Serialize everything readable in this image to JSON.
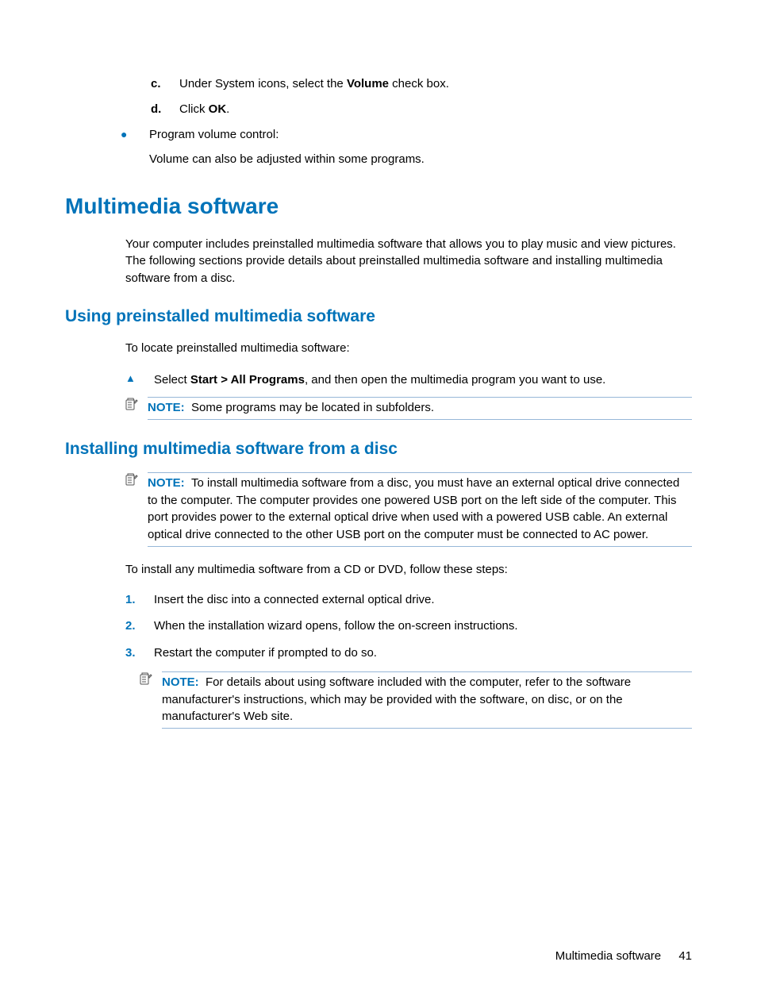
{
  "steps_cd": {
    "c": {
      "letter": "c.",
      "pre": "Under System icons, select the ",
      "bold": "Volume",
      "post": " check box."
    },
    "d": {
      "letter": "d.",
      "pre": "Click ",
      "bold": "OK",
      "post": "."
    }
  },
  "bullet": {
    "title": "Program volume control:",
    "sub": "Volume can also be adjusted within some programs."
  },
  "h1": "Multimedia software",
  "intro": "Your computer includes preinstalled multimedia software that allows you to play music and view pictures. The following sections provide details about preinstalled multimedia software and installing multimedia software from a disc.",
  "h2a": "Using preinstalled multimedia software",
  "locate": "To locate preinstalled multimedia software:",
  "tri_step": {
    "pre": "Select ",
    "bold": "Start > All Programs",
    "post": ", and then open the multimedia program you want to use."
  },
  "note1": {
    "label": "NOTE:",
    "text": "Some programs may be located in subfolders."
  },
  "h2b": "Installing multimedia software from a disc",
  "note2": {
    "label": "NOTE:",
    "text": "To install multimedia software from a disc, you must have an external optical drive connected to the computer. The computer provides one powered USB port on the left side of the computer. This port provides power to the external optical drive when used with a powered USB cable. An external optical drive connected to the other USB port on the computer must be connected to AC power."
  },
  "install_intro": "To install any multimedia software from a CD or DVD, follow these steps:",
  "ol": [
    {
      "num": "1.",
      "text": "Insert the disc into a connected external optical drive."
    },
    {
      "num": "2.",
      "text": "When the installation wizard opens, follow the on-screen instructions."
    },
    {
      "num": "3.",
      "text": "Restart the computer if prompted to do so."
    }
  ],
  "note3": {
    "label": "NOTE:",
    "text": "For details about using software included with the computer, refer to the software manufacturer's instructions, which may be provided with the software, on disc, or on the manufacturer's Web site."
  },
  "footer": {
    "title": "Multimedia software",
    "page": "41"
  }
}
